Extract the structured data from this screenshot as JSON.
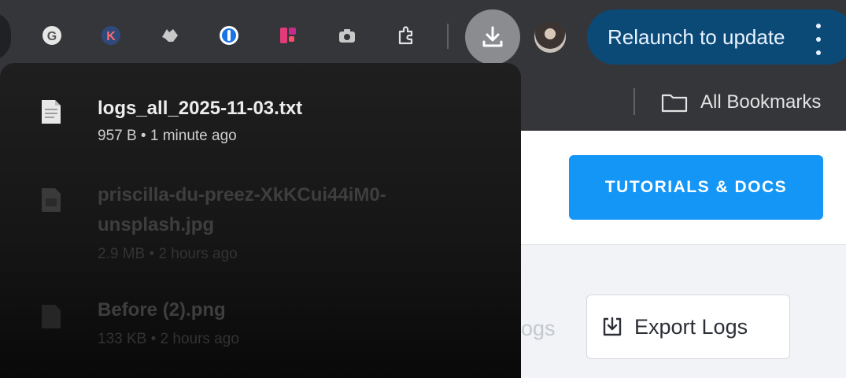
{
  "toolbar": {
    "extensions": [
      {
        "name": "grammarly-icon",
        "glyph": "G"
      },
      {
        "name": "k-extension-icon",
        "glyph": "K"
      },
      {
        "name": "wolf-extension-icon",
        "glyph": ""
      },
      {
        "name": "password-manager-icon",
        "glyph": ""
      },
      {
        "name": "figma-like-extension-icon",
        "glyph": ""
      },
      {
        "name": "camera-icon",
        "glyph": ""
      },
      {
        "name": "puzzle-extensions-icon",
        "glyph": ""
      }
    ],
    "relaunch_label": "Relaunch to update"
  },
  "bookmarks": {
    "all_bookmarks_label": "All Bookmarks"
  },
  "downloads": {
    "items": [
      {
        "filename": "logs_all_2025-11-03.txt",
        "filename_line2": "",
        "meta": "957 B • 1 minute ago"
      },
      {
        "filename": "priscilla-du-preez-XkKCui44iM0-",
        "filename_line2": "unsplash.jpg",
        "meta": "2.9 MB • 2 hours ago"
      },
      {
        "filename": "Before (2).png",
        "filename_line2": "",
        "meta": "133 KB • 2 hours ago"
      }
    ]
  },
  "page": {
    "tutorials_label": "TUTORIALS & DOCS",
    "export_label": "Export Logs",
    "ghost_text": "ogs"
  },
  "colors": {
    "toolbar_bg": "#35363a",
    "relaunch_bg": "#0b4a77",
    "tutorials_bg": "#1496f7",
    "panel_bg": "#1f1f1f"
  }
}
